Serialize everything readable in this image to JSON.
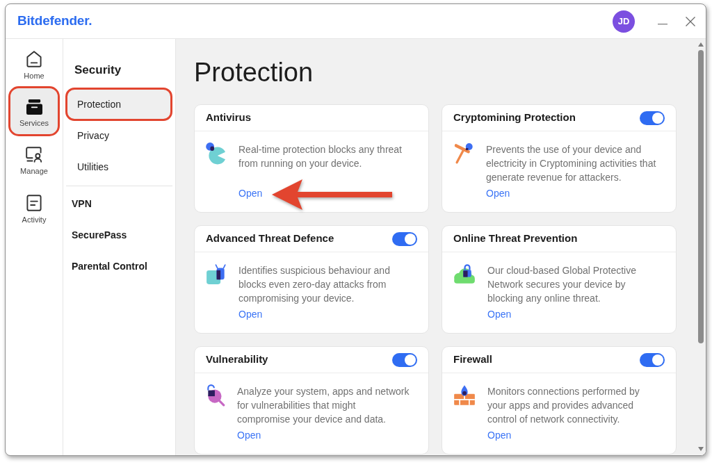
{
  "window": {
    "logo": "Bitdefender.",
    "avatar": "JD"
  },
  "rail": [
    {
      "label": "Home",
      "selected": false,
      "highlighted": false
    },
    {
      "label": "Services",
      "selected": true,
      "highlighted": true
    },
    {
      "label": "Manage",
      "selected": false,
      "highlighted": false
    },
    {
      "label": "Activity",
      "selected": false,
      "highlighted": false
    }
  ],
  "menu": {
    "heading": "Security",
    "items": [
      {
        "label": "Protection",
        "selected": true,
        "highlighted": true
      },
      {
        "label": "Privacy",
        "selected": false,
        "highlighted": false
      },
      {
        "label": "Utilities",
        "selected": false,
        "highlighted": false
      }
    ],
    "sections": [
      "VPN",
      "SecurePass",
      "Parental Control"
    ]
  },
  "page": {
    "title": "Protection"
  },
  "cards": [
    {
      "title": "Antivirus",
      "description": "Real-time protection blocks any threat from running on your device.",
      "link": "Open",
      "annotation_arrow": true
    },
    {
      "title": "Cryptomining Protection",
      "switch": {
        "on": true
      },
      "description": "Prevents the use of your device and electricity in Cryptomining activities that generate revenue for attackers.",
      "link": "Open",
      "annotation_arrow": false
    },
    {
      "title": "Advanced Threat Defence",
      "switch": {
        "on": true
      },
      "description": "Identifies suspicious behaviour and blocks even zero-day attacks from compromising your device.",
      "link": "Open",
      "annotation_arrow": false
    },
    {
      "title": "Online Threat Prevention",
      "description": "Our cloud-based Global Protective Network secures your device by blocking any online threat.",
      "link": "Open",
      "annotation_arrow": false
    },
    {
      "title": "Vulnerability",
      "switch": {
        "on": true
      },
      "description": "Analyze your system, apps and network for vulnerabilities that might compromise your device and data.",
      "link": "Open",
      "annotation_arrow": false
    },
    {
      "title": "Firewall",
      "switch": {
        "on": true
      },
      "description": "Monitors connections performed by your apps and provides advanced control of network connectivity.",
      "link": "Open",
      "annotation_arrow": false
    }
  ]
}
